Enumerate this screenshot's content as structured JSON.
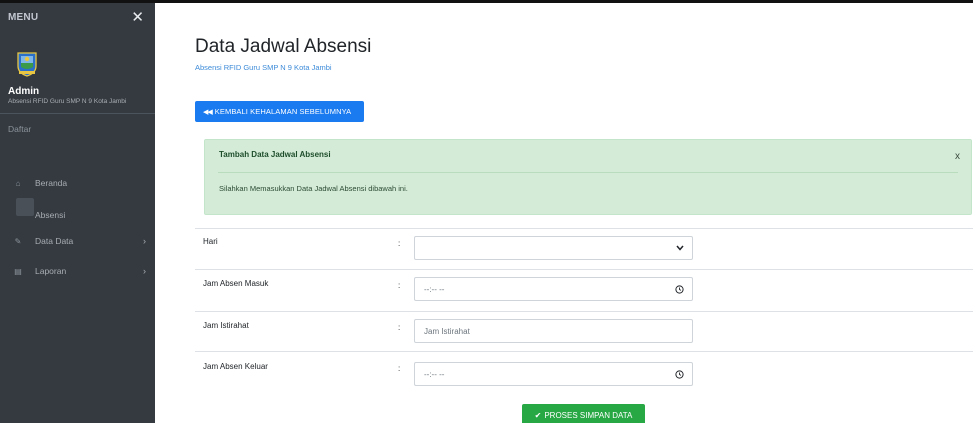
{
  "sidebar": {
    "menu_label": "MENU",
    "close_glyph": "✕",
    "user_name": "Admin",
    "user_subtitle": "Absensi RFID Guru SMP N 9 Kota Jambi",
    "section_label": "Daftar",
    "items": [
      {
        "label": "Beranda",
        "icon": "home-icon",
        "glyph": "⌂",
        "chevron": ""
      },
      {
        "label": "Absensi",
        "icon": "",
        "glyph": "",
        "chevron": ""
      },
      {
        "label": "Data Data",
        "icon": "edit-icon",
        "glyph": "✎",
        "chevron": "›"
      },
      {
        "label": "Laporan",
        "icon": "file-icon",
        "glyph": "▤",
        "chevron": "›"
      }
    ]
  },
  "header": {
    "title": "Data Jadwal Absensi",
    "subtitle": "Absensi RFID Guru SMP N 9 Kota Jambi",
    "back_button": "KEMBALI KEHALAMAN SEBELUMNYA"
  },
  "alert": {
    "title": "Tambah Data Jadwal Absensi",
    "close": "x",
    "message": "Silahkan Memasukkan Data Jadwal Absensi dibawah ini."
  },
  "form": {
    "colon": ":",
    "fields": [
      {
        "label": "Hari",
        "type": "select",
        "value": ""
      },
      {
        "label": "Jam Absen Masuk",
        "type": "time",
        "value": "--:-- --"
      },
      {
        "label": "Jam Istirahat",
        "type": "text",
        "placeholder": "Jam Istirahat"
      },
      {
        "label": "Jam Absen Keluar",
        "type": "time",
        "value": "--:-- --"
      }
    ],
    "submit_label": "PROSES SIMPAN DATA"
  },
  "colors": {
    "sidebar_bg": "#343a40",
    "primary": "#1a7bf0",
    "success": "#28a745",
    "alert_bg": "#d4ecd7"
  }
}
